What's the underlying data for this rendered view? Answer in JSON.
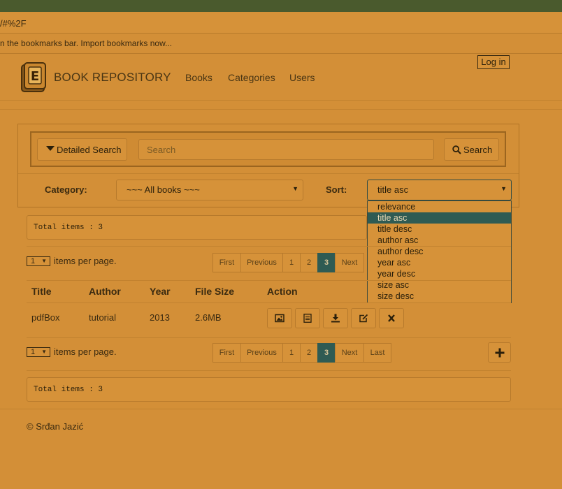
{
  "browser": {
    "url_fragment": "/#%2F",
    "bookmarks_hint": "n the bookmarks bar. Import bookmarks now..."
  },
  "navbar": {
    "brand": "BOOK REPOSITORY",
    "links": [
      "Books",
      "Categories",
      "Users"
    ],
    "login_label": "Log in"
  },
  "search": {
    "detailed_label": "Detailed Search",
    "placeholder": "Search",
    "button_label": "Search",
    "category_label": "Category:",
    "category_value": "~~~ All books ~~~",
    "sort_label": "Sort:",
    "sort_value": "title asc",
    "sort_options": [
      "relevance",
      "title asc",
      "title desc",
      "author asc",
      "author desc",
      "year asc",
      "year desc",
      "size asc",
      "size desc"
    ],
    "sort_selected_index": 1
  },
  "list": {
    "total_items_top": "Total items : 3",
    "total_items_bottom": "Total items : 3",
    "per_page_value": "1",
    "per_page_label": "items per page.",
    "pager_top": [
      "First",
      "Previous",
      "1",
      "2",
      "3",
      "Next"
    ],
    "pager_bottom": [
      "First",
      "Previous",
      "1",
      "2",
      "3",
      "Next",
      "Last"
    ],
    "current_page": "3",
    "headers": [
      "Title",
      "Author",
      "Year",
      "File Size",
      "Action"
    ],
    "rows": [
      {
        "title": "pdfBox",
        "author": "tutorial",
        "year": "2013",
        "size": "2.6MB"
      }
    ],
    "action_icons": [
      "image-icon",
      "details-icon",
      "download-icon",
      "edit-icon",
      "delete-icon"
    ]
  },
  "footer": {
    "text": "© Srđan Jazić"
  },
  "colors": {
    "background": "#d38f37",
    "active": "#2f5b53",
    "topbar": "#4a5a2d"
  }
}
